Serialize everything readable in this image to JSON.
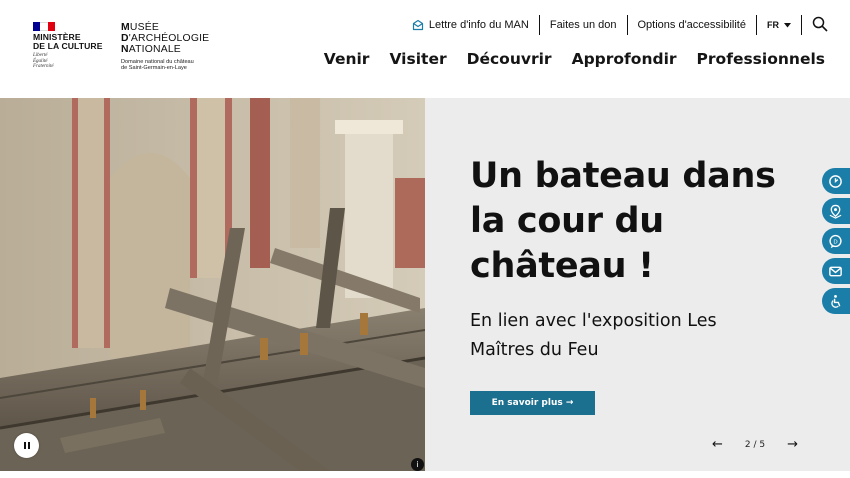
{
  "header": {
    "ministry": {
      "name_lines": [
        "MINISTÈRE",
        "DE LA CULTURE"
      ],
      "motto_lines": [
        "Liberté",
        "Égalité",
        "Fraternité"
      ],
      "flag_colors": [
        "#000091",
        "#ffffff",
        "#e1000f"
      ]
    },
    "museum": {
      "line1_initial": "M",
      "line1_rest": "USÉE",
      "line2_initial": "D",
      "line2_rest": "'ARCHÉOLOGIE",
      "line3_initial": "N",
      "line3_rest": "ATIONALE",
      "subtitle_lines": [
        "Domaine national du château",
        "de Saint-Germain-en-Laye"
      ]
    },
    "topbar": {
      "newsletter_icon": "envelope-open-icon",
      "newsletter": "Lettre d'info du MAN",
      "donate": "Faites un don",
      "accessibility": "Options d'accessibilité",
      "language": "FR",
      "language_icon": "caret-down-icon",
      "search_icon": "search-icon"
    },
    "nav": [
      "Venir",
      "Visiter",
      "Découvrir",
      "Approfondir",
      "Professionnels"
    ]
  },
  "hero": {
    "title_lines": [
      "Un bateau dans",
      "la cour du",
      "château !"
    ],
    "subtitle_lines": [
      "En lien avec l'exposition Les",
      "Maîtres du Feu"
    ],
    "cta": "En savoir plus  →",
    "pager": {
      "prev": "←",
      "status": "2 / 5",
      "next": "→"
    },
    "pause_icon": "pause-icon",
    "info": "i",
    "image": "wooden-boat-wreck-in-castle-courtyard"
  },
  "tools": [
    {
      "icon": "clock-icon"
    },
    {
      "icon": "map-pin-icon"
    },
    {
      "icon": "chat-icon"
    },
    {
      "icon": "mail-icon"
    },
    {
      "icon": "accessibility-icon"
    }
  ],
  "colors": {
    "accent": "#1b6f8f",
    "tools": "#1b7ea8",
    "hero_bg": "#ececec",
    "newsletter_icon": "#1b7ea8"
  }
}
